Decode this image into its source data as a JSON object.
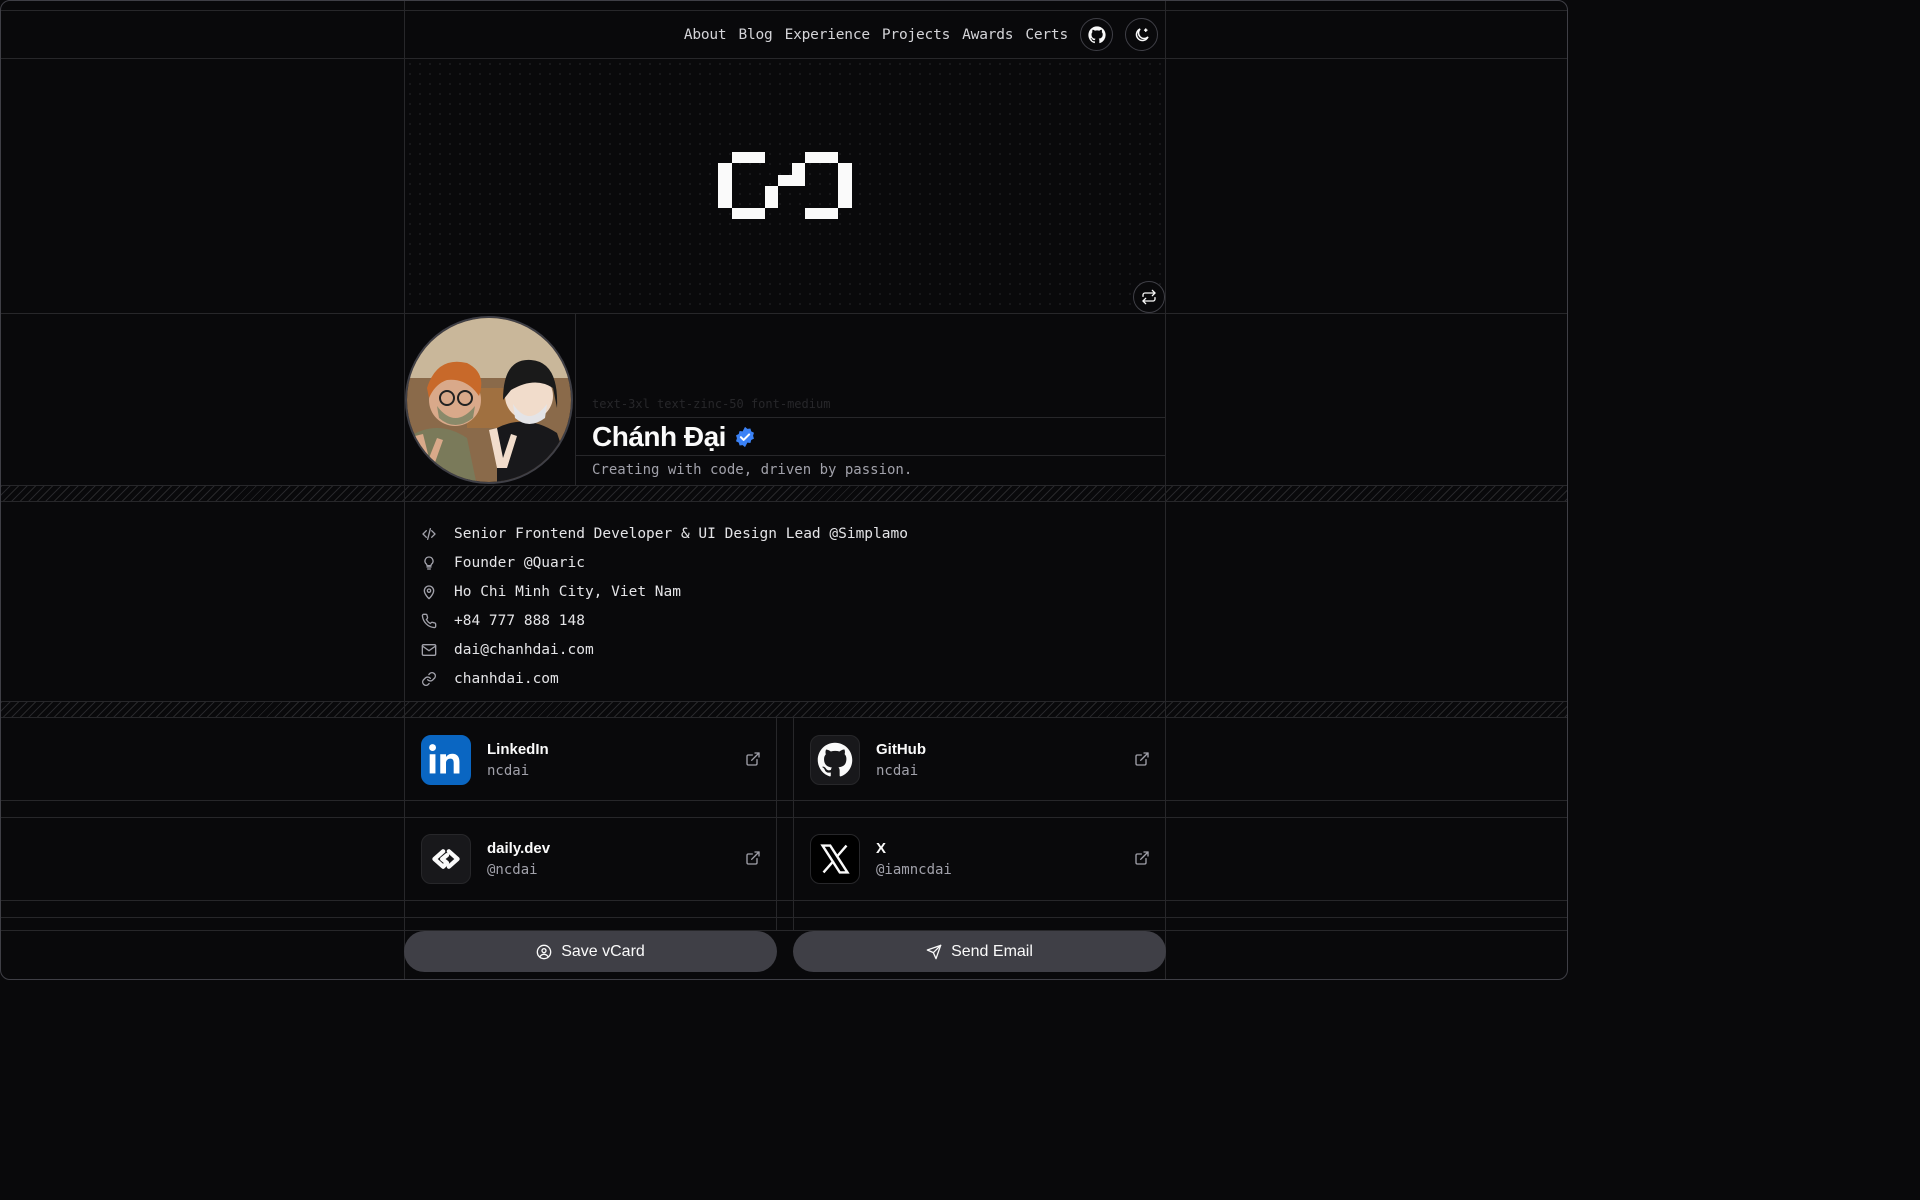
{
  "nav": {
    "links": [
      "About",
      "Blog",
      "Experience",
      "Projects",
      "Awards",
      "Certs"
    ],
    "github_icon": "github-icon",
    "theme_icon": "moon-icon"
  },
  "hero": {
    "logo": "pixel-logo",
    "swap_icon": "swap-icon"
  },
  "profile": {
    "class_hint": "text-3xl text-zinc-50 font-medium",
    "name": "Chánh Đại",
    "verified_icon": "verified-badge-icon",
    "tagline": "Creating with code, driven by passion."
  },
  "info": [
    {
      "icon": "code-icon",
      "text": "Senior Frontend Developer & UI Design Lead @Simplamo"
    },
    {
      "icon": "lightbulb-icon",
      "text": "Founder @Quaric"
    },
    {
      "icon": "map-pin-icon",
      "text": "Ho Chi Minh City, Viet Nam"
    },
    {
      "icon": "phone-icon",
      "text": "+84 777 888 148"
    },
    {
      "icon": "mail-icon",
      "text": "dai@chanhdai.com"
    },
    {
      "icon": "link-icon",
      "text": "chanhdai.com"
    }
  ],
  "socials": [
    {
      "name": "LinkedIn",
      "handle": "ncdai",
      "icon": "linkedin-icon"
    },
    {
      "name": "GitHub",
      "handle": "ncdai",
      "icon": "github-icon"
    },
    {
      "name": "daily.dev",
      "handle": "@ncdai",
      "icon": "dailydev-icon"
    },
    {
      "name": "X",
      "handle": "@iamncdai",
      "icon": "x-icon"
    }
  ],
  "actions": {
    "save_vcard": "Save vCard",
    "send_email": "Send Email"
  },
  "colors": {
    "background": "#09090b",
    "border": "#27272a",
    "verified": "#3b82f6",
    "linkedin": "#0a66c2",
    "button": "#3f3f46"
  }
}
